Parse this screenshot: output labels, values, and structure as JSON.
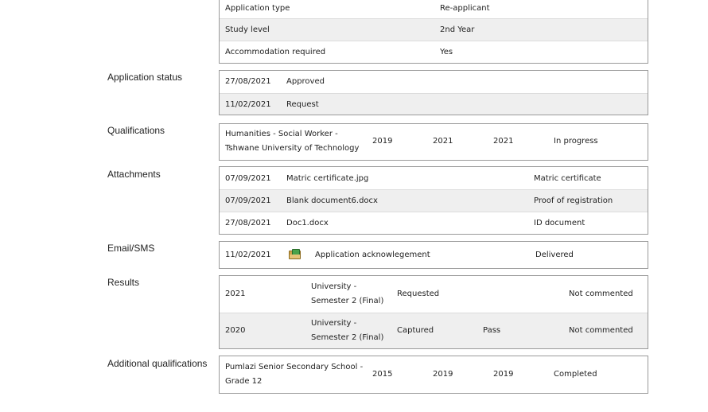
{
  "application_details": [
    {
      "label": "Application type",
      "value": "Re-applicant"
    },
    {
      "label": "Study level",
      "value": "2nd Year"
    },
    {
      "label": "Accommodation required",
      "value": "Yes"
    }
  ],
  "application_status": {
    "label": "Application status",
    "rows": [
      {
        "date": "27/08/2021",
        "status": "Approved"
      },
      {
        "date": "11/02/2021",
        "status": "Request"
      }
    ]
  },
  "qualifications": {
    "label": "Qualifications",
    "rows": [
      {
        "name": "Humanities - Social Worker - Tshwane University of Technology",
        "year1": "2019",
        "year2": "2021",
        "year3": "2021",
        "status": "In progress"
      }
    ]
  },
  "attachments": {
    "label": "Attachments",
    "rows": [
      {
        "date": "07/09/2021",
        "file": "Matric certificate.jpg",
        "type": "Matric certificate"
      },
      {
        "date": "07/09/2021",
        "file": "Blank document6.docx",
        "type": "Proof of registration"
      },
      {
        "date": "27/08/2021",
        "file": "Doc1.docx",
        "type": "ID document"
      }
    ]
  },
  "email_sms": {
    "label": "Email/SMS",
    "rows": [
      {
        "date": "11/02/2021",
        "icon": "envelope-icon",
        "message": "Application acknowlegement",
        "status": "Delivered"
      }
    ]
  },
  "results": {
    "label": "Results",
    "rows": [
      {
        "year": "2021",
        "module": "University - Semester 2 (Final)",
        "state": "Requested",
        "outcome": "",
        "comment": "Not commented"
      },
      {
        "year": "2020",
        "module": "University - Semester 2 (Final)",
        "state": "Captured",
        "outcome": "Pass",
        "comment": "Not commented"
      }
    ]
  },
  "additional_qualifications": {
    "label": "Additional qualifications",
    "rows": [
      {
        "name": "Pumlazi Senior Secondary School - Grade 12",
        "year1": "2015",
        "year2": "2019",
        "year3": "2019",
        "status": "Completed"
      }
    ]
  }
}
